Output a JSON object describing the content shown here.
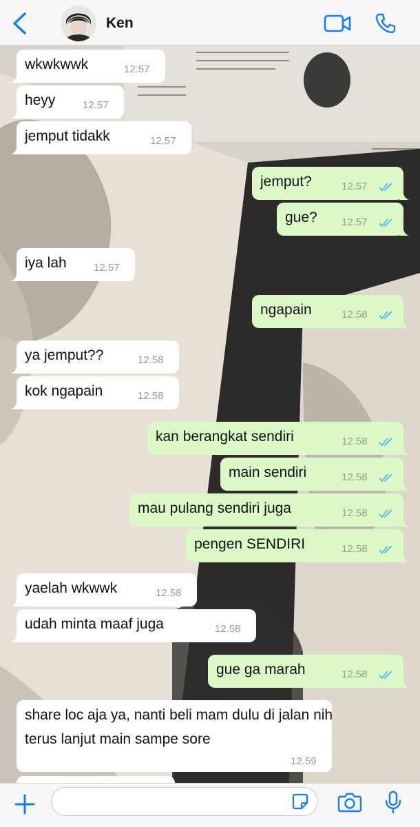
{
  "header": {
    "contact_name": "Ken",
    "back_icon": "chevron-left-icon",
    "video_icon": "video-camera-icon",
    "call_icon": "phone-icon",
    "accent_color": "#1a7cf5"
  },
  "messages": [
    {
      "dir": "in",
      "text": "wkwkwwk",
      "time": "12.57"
    },
    {
      "dir": "in",
      "text": "heyy",
      "time": "12.57"
    },
    {
      "dir": "in",
      "text": "jemput tidakk",
      "time": "12.57"
    },
    {
      "dir": "out",
      "text": "jemput?",
      "time": "12.57",
      "status": "read"
    },
    {
      "dir": "out",
      "text": "gue?",
      "time": "12.57",
      "status": "read"
    },
    {
      "dir": "in",
      "text": "iya lah",
      "time": "12.57"
    },
    {
      "dir": "out",
      "text": "ngapain",
      "time": "12.58",
      "status": "read"
    },
    {
      "dir": "in",
      "text": "ya jemput??",
      "time": "12.58"
    },
    {
      "dir": "in",
      "text": "kok ngapain",
      "time": "12.58"
    },
    {
      "dir": "out",
      "text": "kan berangkat sendiri",
      "time": "12.58",
      "status": "read"
    },
    {
      "dir": "out",
      "text": "main sendiri",
      "time": "12.58",
      "status": "read"
    },
    {
      "dir": "out",
      "text": "mau pulang sendiri juga",
      "time": "12.58",
      "status": "read"
    },
    {
      "dir": "out",
      "text": "pengen SENDIRI",
      "time": "12.58",
      "status": "read"
    },
    {
      "dir": "in",
      "text": "yaelah wkwwk",
      "time": "12.58"
    },
    {
      "dir": "in",
      "text": "udah minta maaf juga",
      "time": "12.58"
    },
    {
      "dir": "out",
      "text": "gue ga marah",
      "time": "12.58",
      "status": "read"
    },
    {
      "dir": "in",
      "text": "share loc aja ya, nanti beli mam dulu di jalan nih terus lanjut main sampe sore",
      "time": "12.59"
    }
  ],
  "input_bar": {
    "placeholder": "",
    "value": "",
    "plus_icon": "plus-icon",
    "sticker_icon": "sticker-icon",
    "camera_icon": "camera-icon",
    "mic_icon": "microphone-icon"
  },
  "colors": {
    "incoming_bubble": "#ffffff",
    "outgoing_bubble": "#dcf8c6",
    "read_ticks": "#4fb6ec"
  }
}
